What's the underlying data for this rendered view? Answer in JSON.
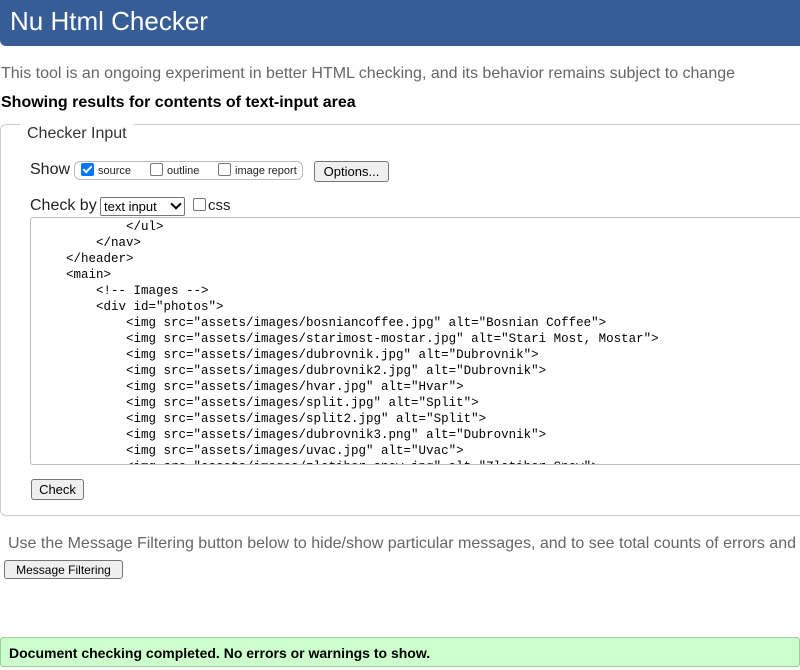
{
  "header": {
    "title": "Nu Html Checker"
  },
  "tagline": "This tool is an ongoing experiment in better HTML checking, and its behavior remains subject to change",
  "results_heading": "Showing results for contents of text-input area",
  "checker": {
    "legend": "Checker Input",
    "show_label": "Show",
    "options": {
      "source": {
        "label": "source",
        "checked": true
      },
      "outline": {
        "label": "outline",
        "checked": false
      },
      "image_report": {
        "label": "image report",
        "checked": false
      }
    },
    "options_button": "Options...",
    "check_by_label": "Check by",
    "check_by_selected": "text input",
    "css": {
      "label": "css",
      "checked": false
    },
    "source_lines": [
      "            </ul>",
      "        </nav>",
      "    </header>",
      "    <main>",
      "        <!-- Images -->",
      "        <div id=\"photos\">",
      "            <img src=\"assets/images/bosniancoffee.jpg\" alt=\"Bosnian Coffee\">",
      "            <img src=\"assets/images/starimost-mostar.jpg\" alt=\"Stari Most, Mostar\">",
      "            <img src=\"assets/images/dubrovnik.jpg\" alt=\"Dubrovnik\">",
      "            <img src=\"assets/images/dubrovnik2.jpg\" alt=\"Dubrovnik\">",
      "            <img src=\"assets/images/hvar.jpg\" alt=\"Hvar\">",
      "            <img src=\"assets/images/split.jpg\" alt=\"Split\">",
      "            <img src=\"assets/images/split2.jpg\" alt=\"Split\">",
      "            <img src=\"assets/images/dubrovnik3.png\" alt=\"Dubrovnik\">",
      "            <img src=\"assets/images/uvac.jpg\" alt=\"Uvac\">",
      "            <img src=\"assets/images/zlatibor-snow.jpg\" alt=\"Zlatibor Snow\">"
    ],
    "check_button": "Check"
  },
  "filter_note": "Use the Message Filtering button below to hide/show particular messages, and to see total counts of errors and",
  "message_filtering_button": "Message Filtering",
  "status_message": "Document checking completed. No errors or warnings to show.",
  "colors": {
    "header_bg": "#365d95",
    "success_bg": "#ccffcc",
    "checkbox_accent": "#0075ff"
  }
}
